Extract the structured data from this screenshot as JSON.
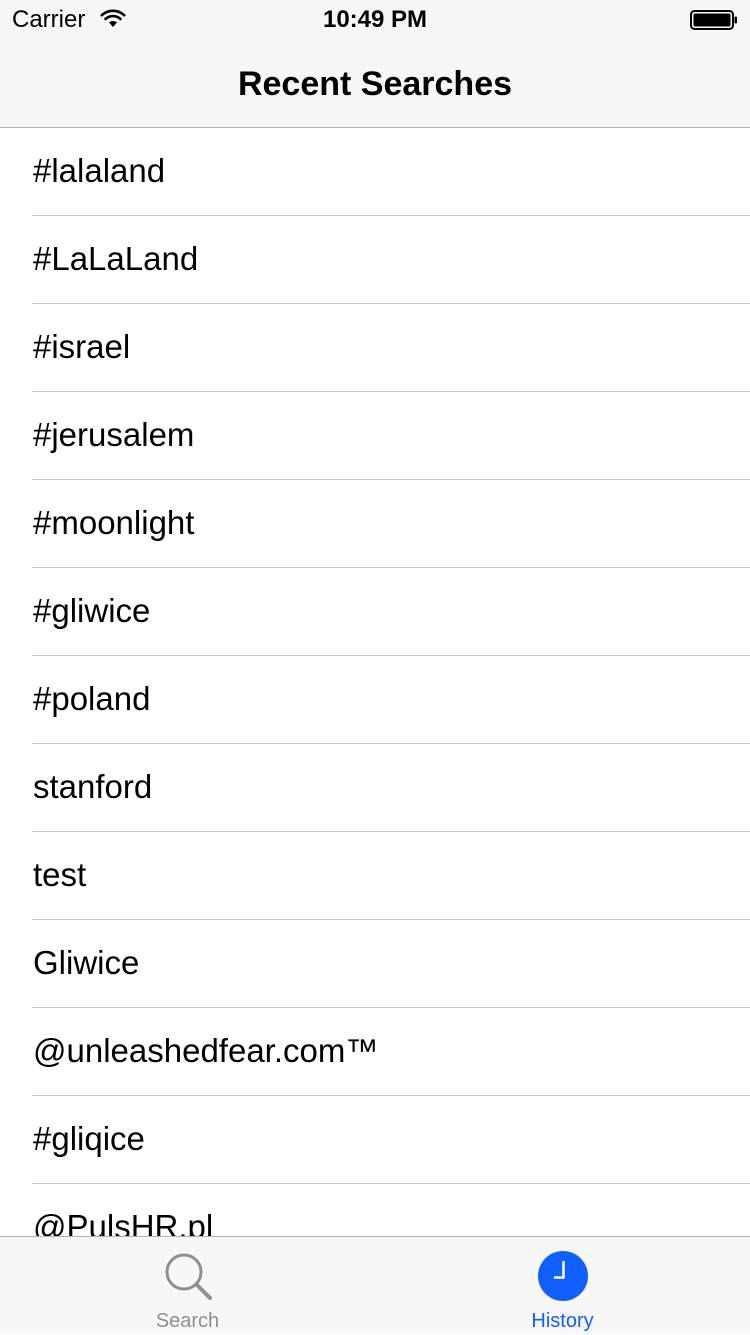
{
  "status_bar": {
    "carrier": "Carrier",
    "time": "10:49 PM"
  },
  "nav": {
    "title": "Recent Searches"
  },
  "searches": [
    "#lalaland",
    "#LaLaLand",
    "#israel",
    "#jerusalem",
    "#moonlight",
    "#gliwice",
    "#poland",
    "stanford",
    "test",
    "Gliwice",
    "@unleashedfear.com™",
    "#gliqice",
    "@PulsHR.pl"
  ],
  "tab_bar": {
    "tabs": [
      {
        "label": "Search",
        "icon": "search-icon",
        "selected": false
      },
      {
        "label": "History",
        "icon": "clock-icon",
        "selected": true
      }
    ]
  },
  "colors": {
    "accent": "#0f5fff",
    "inactive": "#8e8e93",
    "bar_background": "#f7f7f7",
    "separator": "#c8c7cc"
  }
}
